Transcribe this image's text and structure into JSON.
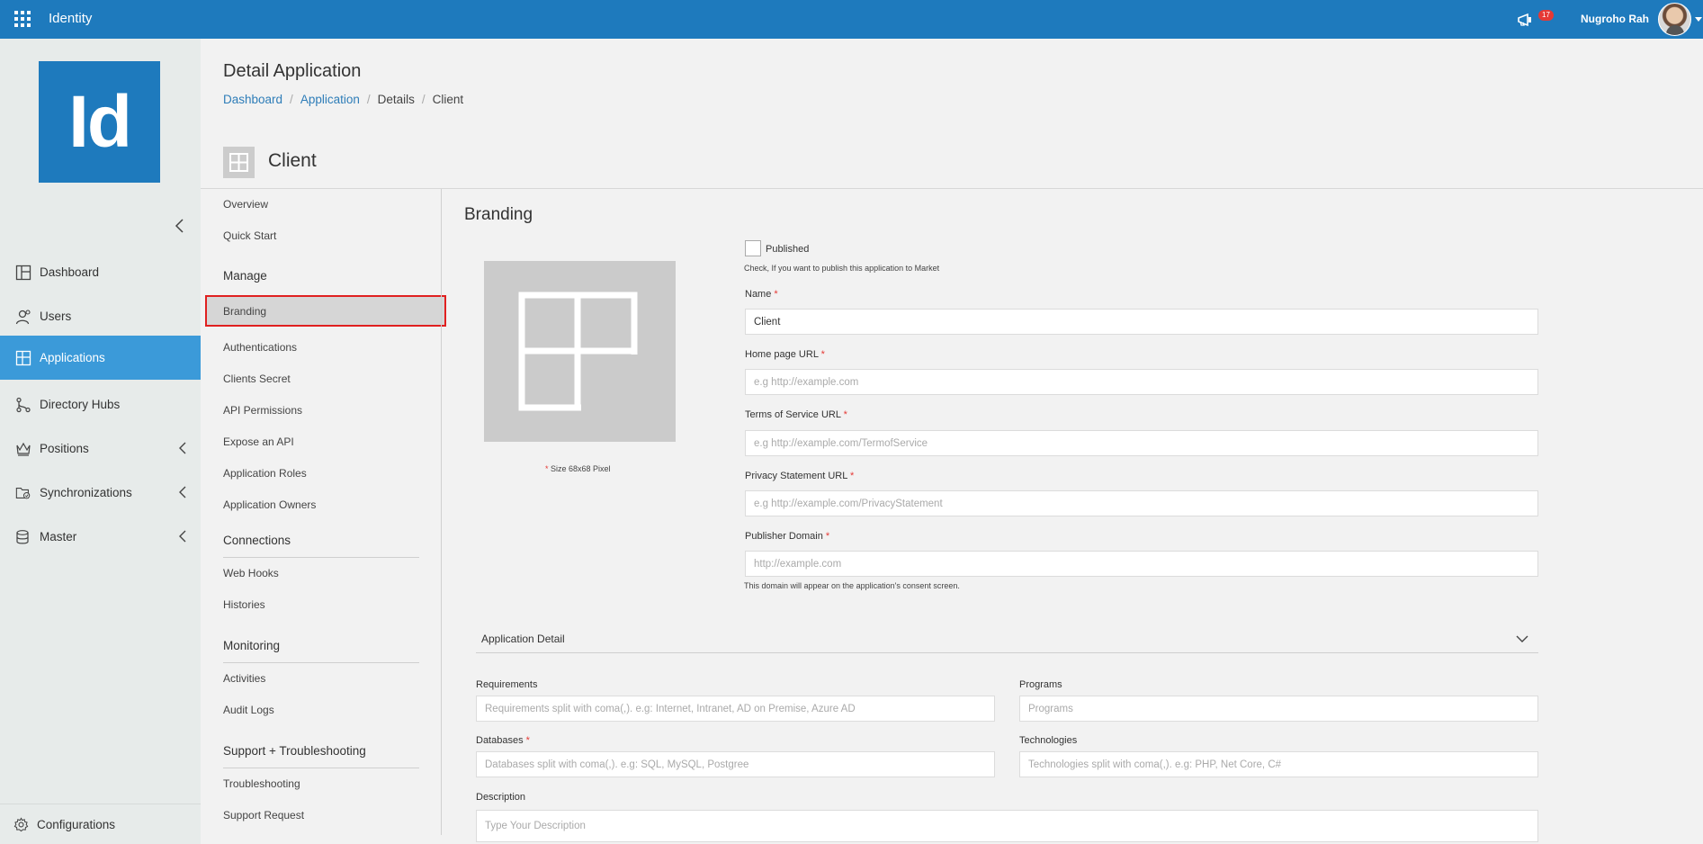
{
  "app": {
    "title": "Identity",
    "logo_text": "Id"
  },
  "header": {
    "user_name": "Nugroho Rah",
    "notification_count": "17"
  },
  "nav": {
    "items": [
      {
        "label": "Dashboard",
        "icon": "dashboard-icon"
      },
      {
        "label": "Users",
        "icon": "users-icon"
      },
      {
        "label": "Applications",
        "icon": "applications-icon",
        "active": true
      },
      {
        "label": "Directory Hubs",
        "icon": "directory-hubs-icon"
      },
      {
        "label": "Positions",
        "icon": "positions-icon",
        "expandable": true
      },
      {
        "label": "Synchronizations",
        "icon": "synchronizations-icon",
        "expandable": true
      },
      {
        "label": "Master",
        "icon": "master-icon",
        "expandable": true
      }
    ],
    "config_label": "Configurations"
  },
  "page": {
    "title": "Detail Application",
    "breadcrumb": [
      "Dashboard",
      "Application",
      "Details",
      "Client"
    ],
    "client_name": "Client"
  },
  "subnav": {
    "top": [
      "Overview",
      "Quick Start"
    ],
    "manage_title": "Manage",
    "manage": [
      "Branding",
      "Authentications",
      "Clients Secret",
      "API Permissions",
      "Expose an API",
      "Application Roles",
      "Application Owners"
    ],
    "connections_title": "Connections",
    "connections": [
      "Web Hooks",
      "Histories"
    ],
    "monitoring_title": "Monitoring",
    "monitoring": [
      "Activities",
      "Audit Logs"
    ],
    "support_title": "Support + Troubleshooting",
    "support": [
      "Troubleshooting",
      "Support Request"
    ]
  },
  "branding": {
    "title": "Branding",
    "size_note": "Size 68x68 Pixel",
    "published_label": "Published",
    "published_hint": "Check, If you want to publish this application to Market",
    "published_checked": false,
    "name": {
      "label": "Name",
      "value": "Client"
    },
    "homepage": {
      "label": "Home page URL",
      "placeholder": "e.g http://example.com"
    },
    "tos": {
      "label": "Terms of Service URL",
      "placeholder": "e.g http://example.com/TermofService"
    },
    "privacy": {
      "label": "Privacy Statement URL",
      "placeholder": "e.g http://example.com/PrivacyStatement"
    },
    "publisher": {
      "label": "Publisher Domain",
      "placeholder": "http://example.com",
      "hint": "This domain will appear on the application's consent screen."
    }
  },
  "detail": {
    "accordion_label": "Application Detail",
    "requirements": {
      "label": "Requirements",
      "placeholder": "Requirements split with coma(,). e.g: Internet, Intranet, AD on Premise, Azure AD"
    },
    "programs": {
      "label": "Programs",
      "placeholder": "Programs"
    },
    "databases": {
      "label": "Databases",
      "placeholder": "Databases split with coma(,). e.g: SQL, MySQL, Postgree"
    },
    "technologies": {
      "label": "Technologies",
      "placeholder": "Technologies split with coma(,). e.g: PHP, Net Core, C#"
    },
    "description": {
      "label": "Description",
      "placeholder": "Type Your Description"
    }
  },
  "colors": {
    "brand": "#1e7abd",
    "active_nav": "#3b9ad9",
    "highlight": "#e02020"
  }
}
